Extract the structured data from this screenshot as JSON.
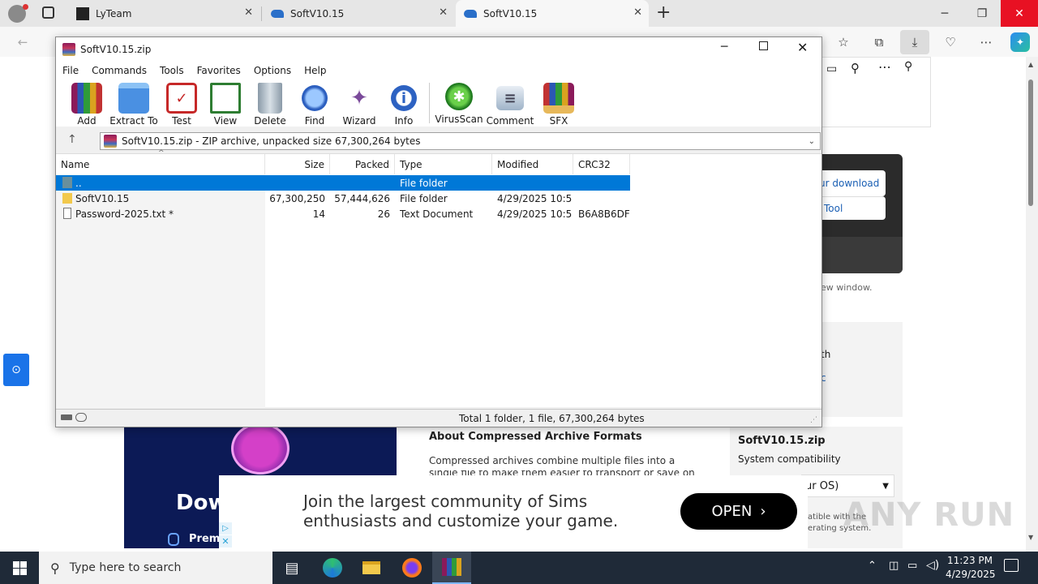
{
  "browser": {
    "tabs": [
      {
        "label": "LyTeam"
      },
      {
        "label": "SoftV10.15"
      },
      {
        "label": "SoftV10.15"
      }
    ],
    "new_tab": "+"
  },
  "winrar": {
    "title": "SoftV10.15.zip",
    "menu": [
      "File",
      "Commands",
      "Tools",
      "Favorites",
      "Options",
      "Help"
    ],
    "toolbar": [
      "Add",
      "Extract To",
      "Test",
      "View",
      "Delete",
      "Find",
      "Wizard",
      "Info",
      "VirusScan",
      "Comment",
      "SFX"
    ],
    "path": "SoftV10.15.zip - ZIP archive, unpacked size 67,300,264 bytes",
    "columns": [
      "Name",
      "Size",
      "Packed",
      "Type",
      "Modified",
      "CRC32"
    ],
    "rows": [
      {
        "name": "..",
        "size": "",
        "packed": "",
        "type": "File folder",
        "modified": "",
        "crc": ""
      },
      {
        "name": "SoftV10.15",
        "size": "67,300,250",
        "packed": "57,444,626",
        "type": "File folder",
        "modified": "4/29/2025 10:5...",
        "crc": ""
      },
      {
        "name": "Password-2025.txt *",
        "size": "14",
        "packed": "26",
        "type": "Text Document",
        "modified": "4/29/2025 10:5...",
        "crc": "B6A8B6DF"
      }
    ],
    "status": "Total 1 folder, 1 file, 67,300,264 bytes"
  },
  "site": {
    "download_btn": "ur download",
    "tool_btn": "Tool",
    "new_window": "ew window.",
    "th": "th",
    "c": "c",
    "about_title": "About Compressed Archive Formats",
    "about_text": "Compressed archives combine multiple files into a",
    "about_text2": "single file to make them easier to transport or save on",
    "side_title": "SoftV10.15.zip",
    "side_sub": "System compatibility",
    "select_value": "ur OS)",
    "compat1": "atible with the",
    "compat2": "erating system.",
    "promo_big": "Dow",
    "promo_small": "Premi"
  },
  "ad": {
    "line1": "Join the largest community of Sims",
    "line2": "enthusiasts and customize your game.",
    "open": "OPEN"
  },
  "watermark": "ANY RUN",
  "taskbar": {
    "search_placeholder": "Type here to search",
    "time": "11:23 PM",
    "date": "4/29/2025"
  }
}
